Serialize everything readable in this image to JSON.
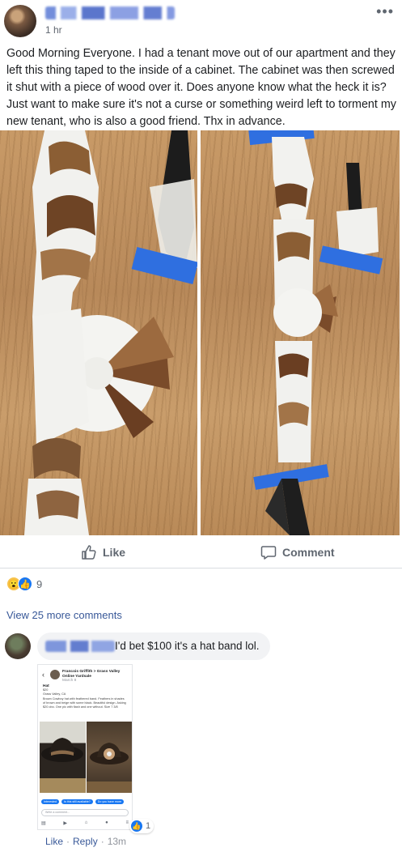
{
  "post": {
    "author_name": "",
    "timestamp": "1 hr",
    "more_icon": "more-dots-icon",
    "text": "Good Morning Everyone. I had a tenant move out of our apartment and they left this thing taped to the inside of a cabinet. The cabinet was then screwed it shut with a piece of wood over it. Does anyone know what the heck it is? Just want to make sure it's not a curse or something weird left to torment my new tenant, who is also a good friend. Thx in advance."
  },
  "actions": {
    "like_label": "Like",
    "comment_label": "Comment"
  },
  "reactions": {
    "types": [
      "wow",
      "like"
    ],
    "count": "9"
  },
  "comments": {
    "view_more_label": "View 25 more comments",
    "items": [
      {
        "author_name": "",
        "text": "I'd bet $100 it's a hat band lol.",
        "reaction_count": "1",
        "like_label": "Like",
        "reply_label": "Reply",
        "time": "13m",
        "attachment": {
          "header_name": "Francois Griffith > Grass Valley Online Yardsale",
          "header_meta": "March 8",
          "title": "Hat",
          "price": "$20",
          "location": "Grass Valley, CA",
          "description": "Brown Cowboy hat with feathered band. Feathers in shades of brown and beige with some black. Beautiful design. Asking $20 obo. One pic with flash and one without. Size 7 3/8",
          "chips": [
            "Interested",
            "Is this still available?",
            "Do you have more"
          ],
          "input_placeholder": "Write a comment..."
        }
      }
    ]
  },
  "colors": {
    "link": "#385898",
    "secondary_text": "#606770",
    "like_blue": "#1877f2",
    "wow_yellow": "#f7c34b",
    "tape_blue": "#2f6fe0"
  }
}
